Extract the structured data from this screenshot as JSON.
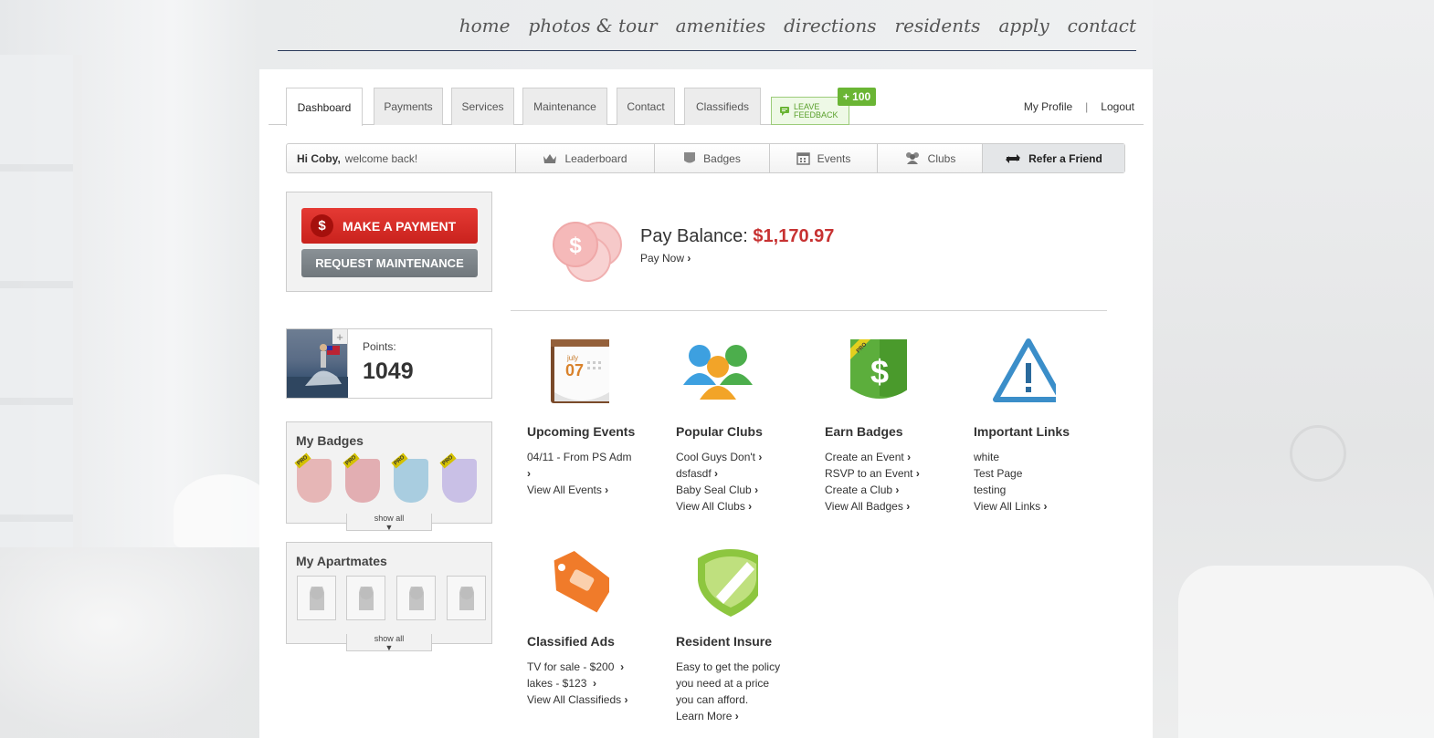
{
  "topnav": [
    "home",
    "photos & tour",
    "amenities",
    "directions",
    "residents",
    "apply",
    "contact"
  ],
  "tabs": [
    "Dashboard",
    "Payments",
    "Services",
    "Maintenance",
    "Contact",
    "Classifieds"
  ],
  "feedback": {
    "line1": "LEAVE",
    "line2": "FEEDBACK",
    "badge": "+ 100"
  },
  "profile": {
    "my_profile": "My Profile",
    "sep": "|",
    "logout": "Logout"
  },
  "subbar": {
    "greeting": "Hi Coby,",
    "welcome": "welcome back!",
    "items": [
      "Leaderboard",
      "Badges",
      "Events",
      "Clubs"
    ],
    "refer": "Refer a Friend"
  },
  "actions": {
    "pay": "MAKE A PAYMENT",
    "maint": "REQUEST MAINTENANCE"
  },
  "points": {
    "label": "Points:",
    "value": "1049",
    "plus": "+"
  },
  "badges": {
    "title": "My Badges",
    "show_all": "show all",
    "pro": "PRO",
    "colors": [
      "#e6b6b6",
      "#e2aeb2",
      "#a9cde0",
      "#c9c0e6"
    ]
  },
  "mates": {
    "title": "My Apartmates",
    "show_all": "show all"
  },
  "balance": {
    "label": "Pay Balance:",
    "amount": "$1,170.97",
    "pay_now": "Pay Now",
    "dollar": "$"
  },
  "widgets": {
    "events": {
      "title": "Upcoming Events",
      "cal_month": "july",
      "cal_day": "07",
      "items": [
        "04/11 - From PS Adm",
        "",
        "View All Events"
      ]
    },
    "clubs": {
      "title": "Popular Clubs",
      "items": [
        "Cool Guys Don't",
        "dsfasdf",
        "Baby Seal Club",
        "View All Clubs"
      ]
    },
    "badges": {
      "title": "Earn Badges",
      "items": [
        "Create an Event",
        "RSVP to an Event",
        "Create a Club",
        "View All Badges"
      ]
    },
    "links": {
      "title": "Important Links",
      "items": [
        "white",
        "Test Page",
        "testing",
        "View All Links"
      ]
    },
    "classified": {
      "title": "Classified Ads",
      "items": [
        "TV for sale - $200",
        "lakes - $123",
        "View All Classifieds"
      ]
    },
    "insure": {
      "title": "Resident Insure",
      "items": [
        "Easy to get the policy",
        "you need at a price",
        "you can afford.",
        "Learn More"
      ]
    }
  },
  "colors": {
    "red": "#c73232",
    "green": "#6ab534",
    "accent_blue": "#2a3a5a"
  }
}
